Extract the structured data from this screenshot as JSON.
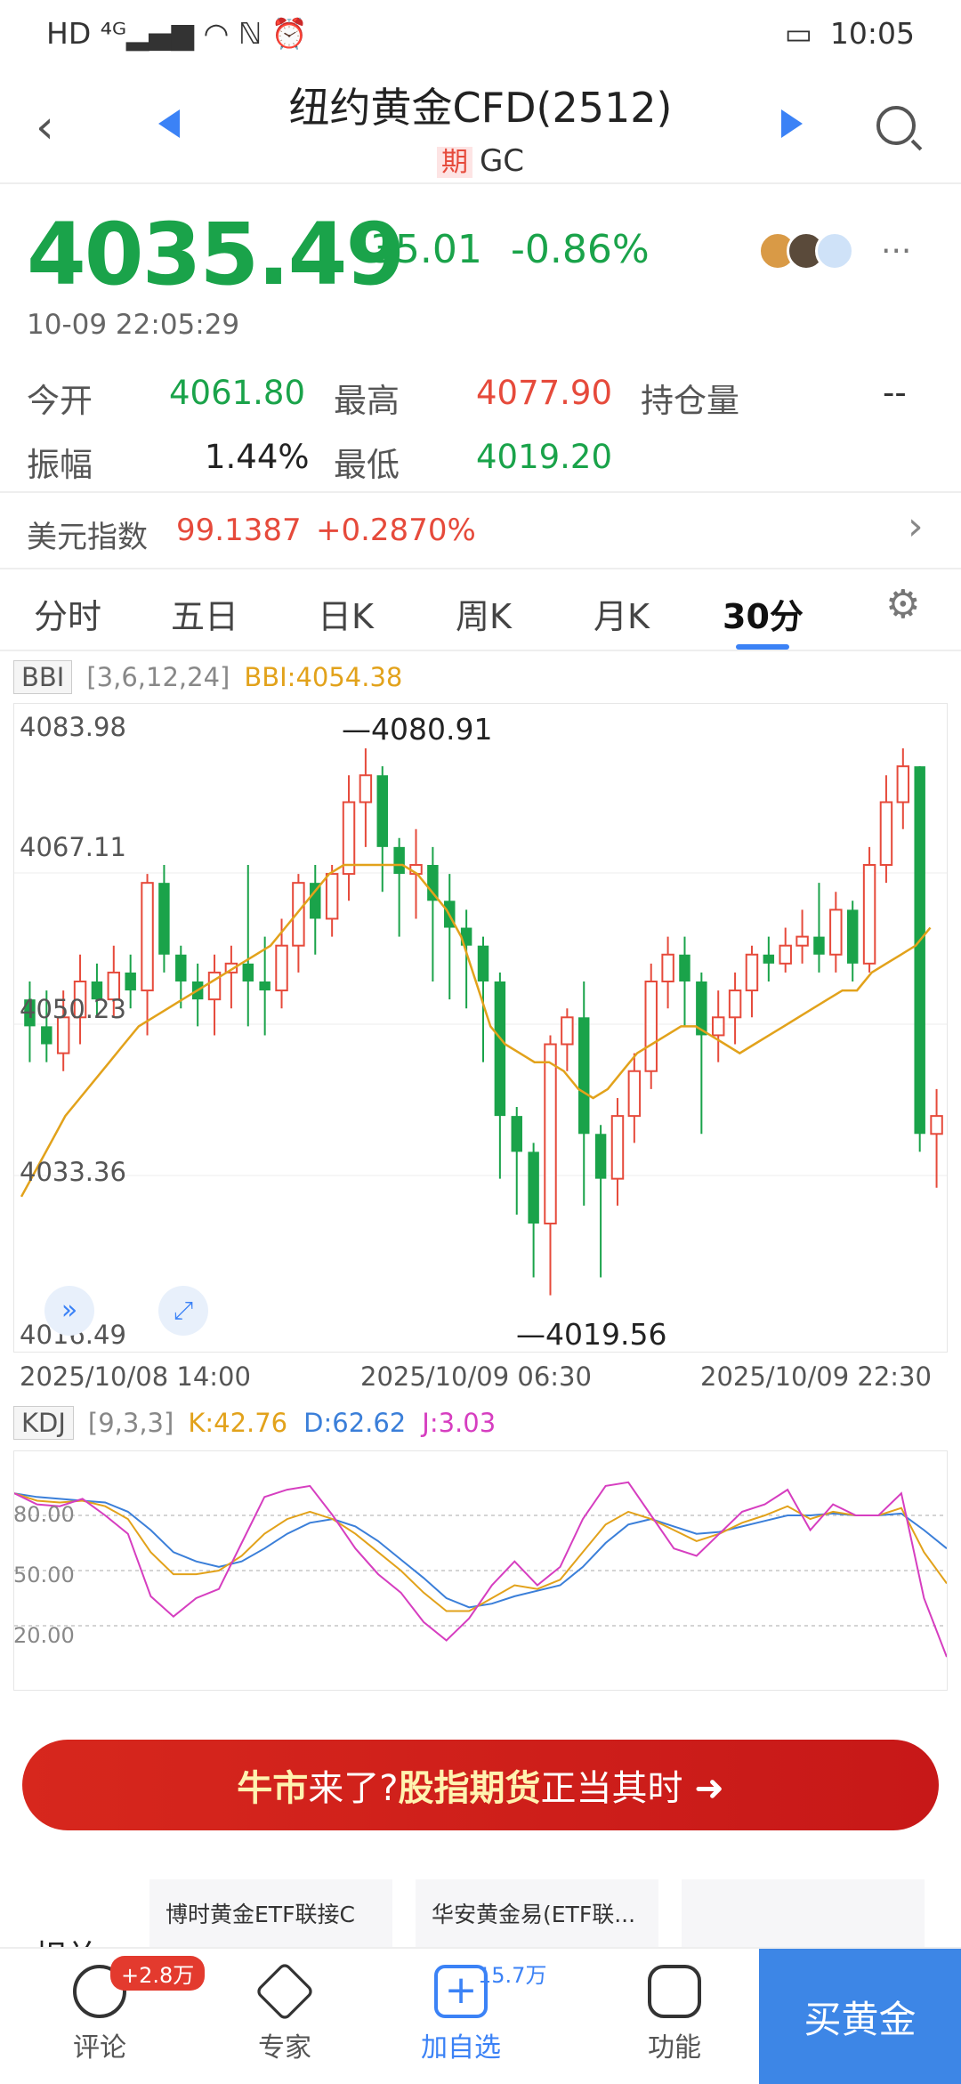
{
  "status": {
    "left": "HD ⁴ᴳ▂▄▆ ◠ ℕ ⏰",
    "time": "10:05"
  },
  "header": {
    "title": "纽约黄金CFD(2512)",
    "tag": "期",
    "code": "GC"
  },
  "quote": {
    "price": "4035.49",
    "change": "-35.01",
    "percent": "-0.86%",
    "time": "10-09 22:05:29",
    "more": "···"
  },
  "stats": {
    "open_l": "今开",
    "open": "4061.80",
    "high_l": "最高",
    "high": "4077.90",
    "oi_l": "持仓量",
    "oi": "--",
    "amp_l": "振幅",
    "amp": "1.44%",
    "low_l": "最低",
    "low": "4019.20"
  },
  "index": {
    "label": "美元指数",
    "value": "99.1387",
    "change": "+0.2870%"
  },
  "tabs": [
    "分时",
    "五日",
    "日K",
    "周K",
    "月K",
    "30分"
  ],
  "main_ind": {
    "name": "BBI",
    "params": "[3,6,12,24]",
    "value": "BBI:4054.38"
  },
  "yaxis": [
    "4083.98",
    "4067.11",
    "4050.23",
    "4033.36",
    "4016.49"
  ],
  "annot": {
    "high": "4080.91",
    "low": "4019.56"
  },
  "dates": [
    "2025/10/08 14:00",
    "2025/10/09 06:30",
    "2025/10/09 22:30"
  ],
  "sub_ind": {
    "name": "KDJ",
    "params": "[9,3,3]",
    "k": "K:42.76",
    "d": "D:62.62",
    "j": "J:3.03"
  },
  "kdj_axis": [
    "80.00",
    "50.00",
    "20.00"
  ],
  "banner": {
    "p1": "牛市",
    "p2": "来了?",
    "p3": "股指期货",
    "p4": "正当其时 ➜"
  },
  "related": {
    "title": "相关",
    "items": [
      "博时黄金ETF联接C",
      "华安黄金易(ETF联...",
      ""
    ]
  },
  "bottom": {
    "comment": "评论",
    "badge": "+2.8万",
    "expert": "专家",
    "watch": "加自选",
    "watch_count": "15.7万",
    "func": "功能",
    "buy": "买黄金"
  },
  "colors": {
    "up": "#e64a3b",
    "down": "#1aa34a",
    "accent": "#3b82f6"
  },
  "chart_data": {
    "type": "candlestick",
    "ylim": [
      4016.49,
      4083.98
    ],
    "bbi": [
      4031,
      4034,
      4037,
      4040,
      4042,
      4044,
      4046,
      4048,
      4050,
      4051,
      4052,
      4053,
      4054,
      4055,
      4056,
      4057,
      4058,
      4059,
      4061,
      4063,
      4065,
      4067,
      4068,
      4068,
      4068,
      4068,
      4068,
      4067,
      4065,
      4063,
      4060,
      4055,
      4050,
      4048,
      4047,
      4046,
      4046,
      4045,
      4043,
      4042,
      4043,
      4045,
      4047,
      4048,
      4049,
      4050,
      4050,
      4049,
      4048,
      4047,
      4048,
      4049,
      4050,
      4051,
      4052,
      4053,
      4054,
      4054,
      4056,
      4057,
      4058,
      4059,
      4061
    ],
    "candles": [
      [
        4053,
        4050,
        4055,
        4046
      ],
      [
        4050,
        4048,
        4054,
        4046
      ],
      [
        4047,
        4051,
        4054,
        4045
      ],
      [
        4051,
        4055,
        4058,
        4048
      ],
      [
        4055,
        4053,
        4057,
        4051
      ],
      [
        4053,
        4056,
        4059,
        4051
      ],
      [
        4056,
        4054,
        4058,
        4052
      ],
      [
        4054,
        4066,
        4067,
        4049
      ],
      [
        4066,
        4058,
        4068,
        4056
      ],
      [
        4058,
        4055,
        4059,
        4052
      ],
      [
        4055,
        4053,
        4057,
        4050
      ],
      [
        4053,
        4056,
        4058,
        4049
      ],
      [
        4056,
        4057,
        4059,
        4052
      ],
      [
        4057,
        4055,
        4068,
        4050
      ],
      [
        4055,
        4054,
        4060,
        4049
      ],
      [
        4054,
        4059,
        4062,
        4052
      ],
      [
        4059,
        4066,
        4067,
        4056
      ],
      [
        4066,
        4062,
        4068,
        4058
      ],
      [
        4062,
        4067,
        4068,
        4060
      ],
      [
        4067,
        4075,
        4078,
        4064
      ],
      [
        4075,
        4078,
        4081,
        4070
      ],
      [
        4078,
        4070,
        4079,
        4065
      ],
      [
        4070,
        4067,
        4071,
        4060
      ],
      [
        4067,
        4068,
        4072,
        4062
      ],
      [
        4068,
        4064,
        4070,
        4055
      ],
      [
        4064,
        4061,
        4067,
        4053
      ],
      [
        4061,
        4059,
        4063,
        4052
      ],
      [
        4059,
        4055,
        4060,
        4046
      ],
      [
        4055,
        4040,
        4056,
        4033
      ],
      [
        4040,
        4036,
        4041,
        4029
      ],
      [
        4036,
        4028,
        4037,
        4022
      ],
      [
        4028,
        4048,
        4049,
        4020
      ],
      [
        4048,
        4051,
        4052,
        4045
      ],
      [
        4051,
        4038,
        4055,
        4030
      ],
      [
        4038,
        4033,
        4039,
        4022
      ],
      [
        4033,
        4040,
        4042,
        4030
      ],
      [
        4040,
        4045,
        4047,
        4037
      ],
      [
        4045,
        4055,
        4057,
        4043
      ],
      [
        4055,
        4058,
        4060,
        4052
      ],
      [
        4058,
        4055,
        4060,
        4050
      ],
      [
        4055,
        4049,
        4056,
        4038
      ],
      [
        4049,
        4051,
        4054,
        4046
      ],
      [
        4051,
        4054,
        4056,
        4048
      ],
      [
        4054,
        4058,
        4059,
        4051
      ],
      [
        4058,
        4057,
        4060,
        4055
      ],
      [
        4057,
        4059,
        4061,
        4056
      ],
      [
        4059,
        4060,
        4063,
        4057
      ],
      [
        4060,
        4058,
        4066,
        4056
      ],
      [
        4058,
        4063,
        4065,
        4056
      ],
      [
        4063,
        4057,
        4064,
        4055
      ],
      [
        4057,
        4068,
        4070,
        4056
      ],
      [
        4068,
        4075,
        4078,
        4066
      ],
      [
        4075,
        4079,
        4081,
        4072
      ],
      [
        4079,
        4038,
        4079,
        4036
      ],
      [
        4038,
        4040,
        4043,
        4032
      ]
    ]
  }
}
